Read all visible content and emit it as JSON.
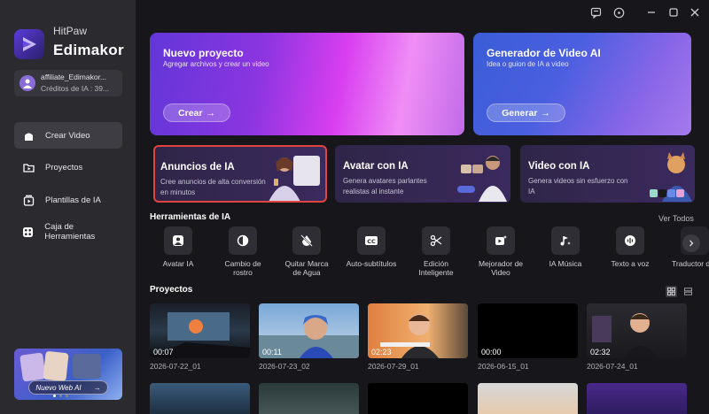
{
  "app": {
    "brand_top": "HitPaw",
    "brand_bottom": "Edimakor"
  },
  "account": {
    "name": "affiliate_Edimakor...",
    "credits": "Créditos de IA : 39..."
  },
  "sidebar": {
    "items": [
      {
        "label": "Crear Video",
        "icon": "home-icon",
        "active": true
      },
      {
        "label": "Proyectos",
        "icon": "folder-icon",
        "active": false
      },
      {
        "label": "Plantillas de IA",
        "icon": "template-icon",
        "active": false
      },
      {
        "label": "Caja de Herramientas",
        "icon": "toolbox-icon",
        "active": false
      }
    ],
    "promo": {
      "label": "Nuevo Web AI",
      "arrow": "→"
    }
  },
  "titlebar": {
    "icons": [
      "feedback-icon",
      "info-icon",
      "minimize-icon",
      "maximize-icon",
      "close-icon"
    ]
  },
  "hero": [
    {
      "title": "Nuevo proyecto",
      "subtitle": "Agregar archivos y crear un video",
      "button": "Crear",
      "arrow": "→"
    },
    {
      "title": "Generador de Video AI",
      "subtitle": "Idea o guion de IA a video",
      "button": "Generar",
      "arrow": "→"
    }
  ],
  "features": [
    {
      "title": "Anuncios de IA",
      "desc": "Cree anuncios de alta conversión en minutos",
      "selected": true
    },
    {
      "title": "Avatar con IA",
      "desc": "Genera avatares parlantes realistas al instante",
      "selected": false
    },
    {
      "title": "Video con IA",
      "desc": "Genera videos sin esfuerzo con IA",
      "selected": false
    }
  ],
  "tools_section": {
    "title": "Herramientas de IA",
    "see_all": "Ver Todos",
    "items": [
      {
        "label": "Avatar IA",
        "icon": "avatar-icon"
      },
      {
        "label": "Cambio de rostro",
        "icon": "face-swap-icon"
      },
      {
        "label": "Quitar Marca de Agua",
        "icon": "watermark-remove-icon"
      },
      {
        "label": "Auto-subtítulos",
        "icon": "subtitles-icon"
      },
      {
        "label": "Edición Inteligente",
        "icon": "smart-edit-icon"
      },
      {
        "label": "Mejorador de Video",
        "icon": "video-enhancer-icon"
      },
      {
        "label": "IA Música",
        "icon": "music-icon"
      },
      {
        "label": "Texto a voz",
        "icon": "text-to-speech-icon"
      },
      {
        "label": "Traductor de video",
        "icon": "translate-icon"
      }
    ]
  },
  "projects_section": {
    "title": "Proyectos",
    "projects": [
      {
        "duration": "00:07",
        "date": "2026-07-22_01"
      },
      {
        "duration": "00:11",
        "date": "2026-07-23_02"
      },
      {
        "duration": "02:23",
        "date": "2026-07-29_01"
      },
      {
        "duration": "00:00",
        "date": "2026-06-15_01"
      },
      {
        "duration": "02:32",
        "date": "2026-07-24_01"
      }
    ]
  },
  "colors": {
    "accent": "#7b3fe4",
    "selected_border": "#e0443e",
    "sidebar_bg": "#2a2a2f",
    "main_bg": "#17171b"
  }
}
